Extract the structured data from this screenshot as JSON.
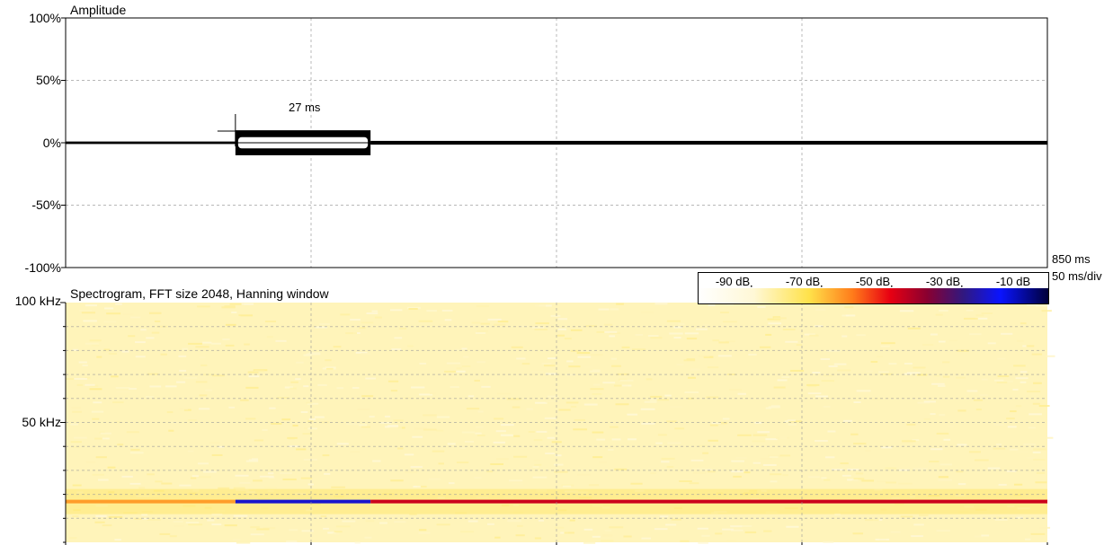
{
  "chart_data": [
    {
      "type": "line",
      "title": "Amplitude",
      "ylabel": "",
      "xlabel": "",
      "ylim": [
        -100,
        100
      ],
      "y_ticks": [
        "100%",
        "50%",
        "0%",
        "-50%",
        "-100%"
      ],
      "y_tick_values": [
        100,
        50,
        0,
        -50,
        -100
      ],
      "xlim": [
        0,
        850
      ],
      "x_unit": "ms",
      "x_end_label": "850 ms",
      "x_div_label": "50 ms/div",
      "x_gridlines_ms": [
        212.5,
        425,
        637.5
      ],
      "grid": true,
      "annotation": {
        "text": "27 ms",
        "t_ms": 147
      },
      "segments": [
        {
          "start_ms": 0,
          "end_ms": 147,
          "amplitude_pct": 1
        },
        {
          "start_ms": 147,
          "end_ms": 264,
          "amplitude_pct": 10
        },
        {
          "start_ms": 264,
          "end_ms": 850,
          "amplitude_pct": 1.5
        }
      ]
    },
    {
      "type": "heatmap",
      "title": "Spectrogram, FFT size 2048, Hanning window",
      "ylim": [
        0,
        100
      ],
      "y_unit": "kHz",
      "y_ticks": [
        "100 kHz",
        "50 kHz"
      ],
      "y_tick_values": [
        100,
        50
      ],
      "xlim": [
        0,
        850
      ],
      "grid": true,
      "colorbar": {
        "labels": [
          "-90 dB",
          "-70 dB",
          "-50 dB",
          "-30 dB",
          "-10 dB"
        ],
        "values": [
          -90,
          -70,
          -50,
          -30,
          -10
        ],
        "stops": [
          {
            "db": -100,
            "color": "#ffffff"
          },
          {
            "db": -85,
            "color": "#fff8d6"
          },
          {
            "db": -70,
            "color": "#ffe24a"
          },
          {
            "db": -58,
            "color": "#ff7a1a"
          },
          {
            "db": -48,
            "color": "#e80012"
          },
          {
            "db": -38,
            "color": "#8a0030"
          },
          {
            "db": -28,
            "color": "#301880"
          },
          {
            "db": -18,
            "color": "#0a14ff"
          },
          {
            "db": -5,
            "color": "#00003a"
          }
        ]
      },
      "background_db": -82,
      "tonal_line": {
        "freq_khz": 17,
        "segments": [
          {
            "start_ms": 0,
            "end_ms": 147,
            "db": -62
          },
          {
            "start_ms": 147,
            "end_ms": 264,
            "db": -22
          },
          {
            "start_ms": 264,
            "end_ms": 850,
            "db": -45
          }
        ]
      }
    }
  ]
}
